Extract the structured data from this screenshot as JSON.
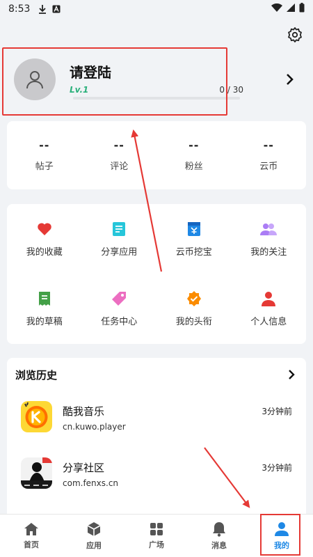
{
  "status_bar": {
    "time": "8:53"
  },
  "profile": {
    "title": "请登陆",
    "level": "Lv.1",
    "progress_text": "0 / 30",
    "progress_fraction": 0
  },
  "stats": [
    {
      "value": "--",
      "label": "帖子"
    },
    {
      "value": "--",
      "label": "评论"
    },
    {
      "value": "--",
      "label": "粉丝"
    },
    {
      "value": "--",
      "label": "云币"
    }
  ],
  "grid": [
    {
      "label": "我的收藏",
      "icon": "heart-icon",
      "color": "#e53935"
    },
    {
      "label": "分享应用",
      "icon": "list-icon",
      "color": "#26c6da"
    },
    {
      "label": "云币挖宝",
      "icon": "treasure-icon",
      "color": "#1e88e5"
    },
    {
      "label": "我的关注",
      "icon": "users-icon",
      "color": "#ab7df5"
    },
    {
      "label": "我的草稿",
      "icon": "draft-icon",
      "color": "#43a047"
    },
    {
      "label": "任务中心",
      "icon": "tag-icon",
      "color": "#ec6ec1"
    },
    {
      "label": "我的头衔",
      "icon": "badge-icon",
      "color": "#fb8c00"
    },
    {
      "label": "个人信息",
      "icon": "person-icon",
      "color": "#e53935"
    }
  ],
  "history": {
    "title": "浏览历史",
    "items": [
      {
        "name": "酷我音乐",
        "package": "cn.kuwo.player",
        "time": "3分钟前",
        "icon": "kuwo-app-icon"
      },
      {
        "name": "分享社区",
        "package": "com.fenxs.cn",
        "time": "3分钟前",
        "icon": "fenxiang-app-icon"
      }
    ]
  },
  "nav": [
    {
      "label": "首页",
      "icon": "home-icon"
    },
    {
      "label": "应用",
      "icon": "cube-icon"
    },
    {
      "label": "广场",
      "icon": "grid-icon"
    },
    {
      "label": "消息",
      "icon": "bell-icon"
    },
    {
      "label": "我的",
      "icon": "person-icon",
      "active": true
    }
  ],
  "colors": {
    "accent": "#1e88e5",
    "level": "#2bb07b",
    "annotation": "#e53935"
  }
}
